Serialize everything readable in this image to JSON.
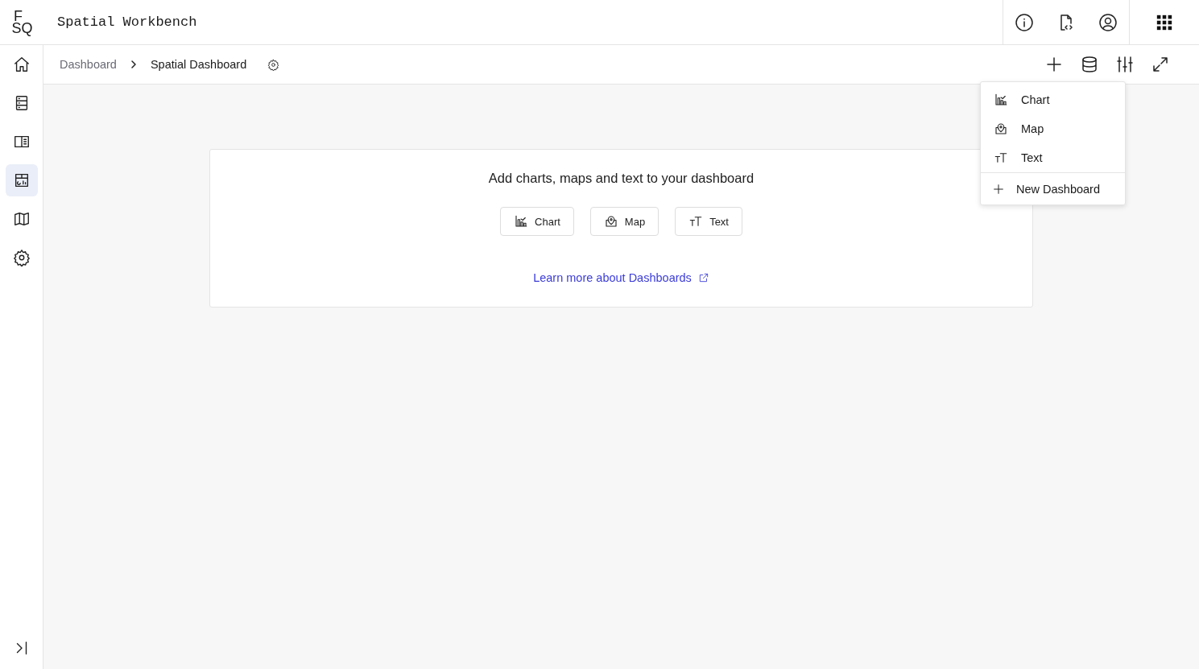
{
  "header": {
    "logo": [
      "F",
      "SQ"
    ],
    "title": "Spatial Workbench"
  },
  "sidebar": {
    "items": [
      {
        "kind": "home",
        "selected": false
      },
      {
        "kind": "data",
        "selected": false
      },
      {
        "kind": "panel",
        "selected": false
      },
      {
        "kind": "dashboard",
        "selected": true
      },
      {
        "kind": "map",
        "selected": false
      },
      {
        "kind": "settings",
        "selected": false
      }
    ]
  },
  "breadcrumbs": [
    "Dashboard",
    "Spatial Dashboard"
  ],
  "empty_state": {
    "message": "Add charts, maps and text to your dashboard",
    "buttons": [
      {
        "kind": "chart",
        "label": "Chart"
      },
      {
        "kind": "map",
        "label": "Map"
      },
      {
        "kind": "text",
        "label": "Text"
      }
    ],
    "link": "Learn more about Dashboards"
  },
  "add_menu": {
    "items": [
      {
        "kind": "chart",
        "label": "Chart"
      },
      {
        "kind": "map",
        "label": "Map"
      },
      {
        "kind": "text",
        "label": "Text"
      }
    ],
    "footer": "New Dashboard"
  }
}
